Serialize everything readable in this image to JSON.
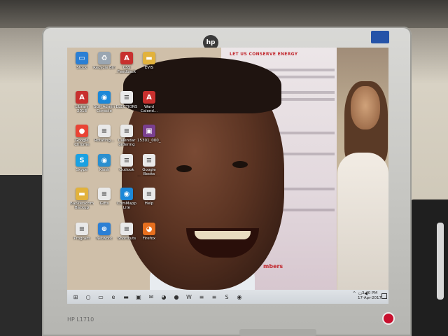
{
  "monitor": {
    "brand": "hp",
    "model": "HP L1710"
  },
  "poster": {
    "title": "LET US CONSERVE ENERGY",
    "footer": "mbers"
  },
  "desktop_icons": [
    {
      "label": "Stock",
      "icon": "pc-icon",
      "color": "#2b7fd4"
    },
    {
      "label": "Recycle Bin",
      "icon": "recycle-bin-icon",
      "color": "#9aa6b2"
    },
    {
      "label": "CSS Feedback Instructions",
      "icon": "pdf-icon",
      "color": "#c8302e"
    },
    {
      "label": "EVIS",
      "icon": "folder-icon",
      "color": "#e2b23c"
    },
    {
      "label": "Library 2018",
      "icon": "pdf-icon",
      "color": "#c8302e"
    },
    {
      "label": "SGP Admin Console",
      "icon": "app-icon",
      "color": "#1c88d8"
    },
    {
      "label": "ELECTIONS",
      "icon": "document-icon",
      "color": "#e9e9e9"
    },
    {
      "label": "Ward Calend...",
      "icon": "pdf-icon",
      "color": "#c8302e"
    },
    {
      "label": "Google Chrome",
      "icon": "chrome-icon",
      "color": "#e94435"
    },
    {
      "label": "Rotating...",
      "icon": "document-icon",
      "color": "#e9e9e9"
    },
    {
      "label": "Calendar ordering",
      "icon": "document-icon",
      "color": "#e9e9e9"
    },
    {
      "label": "15301_000_...",
      "icon": "image-icon",
      "color": "#7a3f8f"
    },
    {
      "label": "Skype",
      "icon": "skype-icon",
      "color": "#1aa1e2"
    },
    {
      "label": "Kiosk",
      "icon": "app-icon",
      "color": "#2a8fcf"
    },
    {
      "label": "Outlook",
      "icon": "document-icon",
      "color": "#e9e9e9"
    },
    {
      "label": "Google Books Downloader",
      "icon": "document-icon",
      "color": "#e9e9e9"
    },
    {
      "label": "Bankerscom Backup",
      "icon": "folder-icon",
      "color": "#e2b23c"
    },
    {
      "label": "Gifts",
      "icon": "document-icon",
      "color": "#e9e9e9"
    },
    {
      "label": "ComMapp Lite",
      "icon": "app-icon",
      "color": "#1c88d8"
    },
    {
      "label": "Help",
      "icon": "document-icon",
      "color": "#e9e9e9"
    },
    {
      "label": "Program",
      "icon": "document-icon",
      "color": "#e9e9e9"
    },
    {
      "label": "Network",
      "icon": "network-icon",
      "color": "#2b7fd4"
    },
    {
      "label": "Shortcuts",
      "icon": "document-icon",
      "color": "#e9e9e9"
    },
    {
      "label": "Firefox",
      "icon": "firefox-icon",
      "color": "#e76f1e"
    }
  ],
  "taskbar": {
    "apps": [
      "windows-start-icon",
      "search-icon",
      "task-view-icon",
      "edge-icon",
      "file-explorer-icon",
      "store-icon",
      "mail-icon",
      "firefox-icon",
      "chrome-icon",
      "word-icon",
      "document-icon",
      "document-icon",
      "skype-icon",
      "app-icon"
    ],
    "time": "3:40 PM",
    "date": "17-Apr-2017"
  }
}
